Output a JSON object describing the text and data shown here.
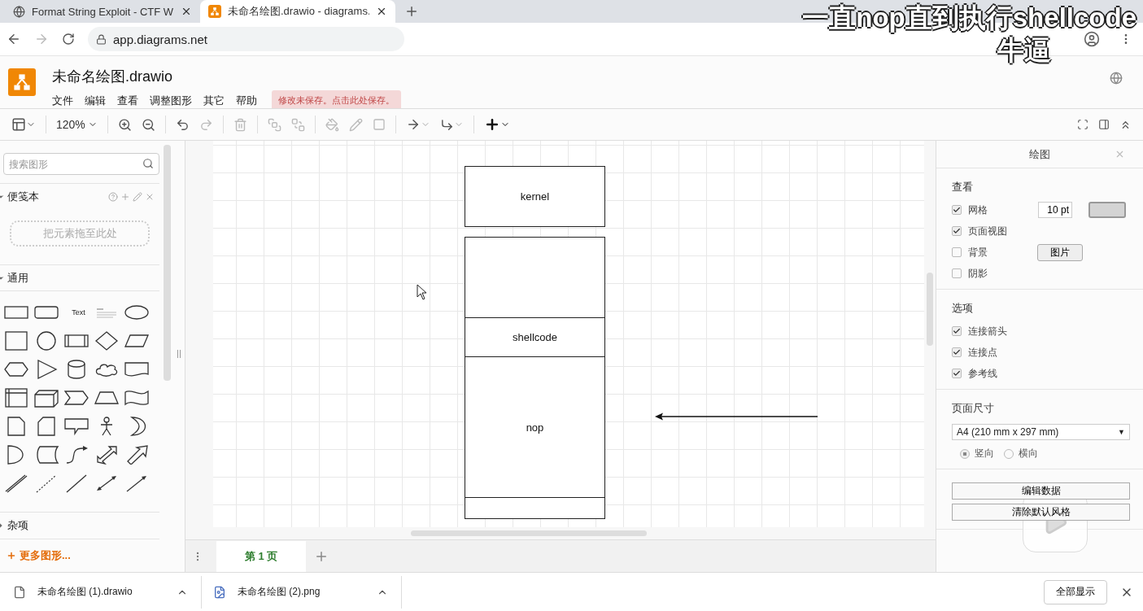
{
  "browser": {
    "tabs": [
      {
        "title": "Format String Exploit - CTF W",
        "selected": false,
        "kind": "web"
      },
      {
        "title": "未命名绘图.drawio - diagrams.",
        "selected": true,
        "kind": "drawio"
      }
    ],
    "url": "app.diagrams.net",
    "downloads": [
      {
        "name": "未命名绘图 (1).drawio",
        "kind": "file"
      },
      {
        "name": "未命名绘图 (2).png",
        "kind": "image"
      }
    ],
    "show_all": "全部显示"
  },
  "app": {
    "title": "未命名绘图.drawio",
    "menu": [
      "文件",
      "编辑",
      "查看",
      "调整图形",
      "其它",
      "帮助"
    ],
    "save_notice": "修改未保存。点击此处保存。",
    "zoom": "120%"
  },
  "sidebar": {
    "search_placeholder": "搜索图形",
    "sections": [
      {
        "title": "便笺本",
        "expanded": true,
        "kind": "scratchpad",
        "drop_hint": "把元素拖至此处"
      },
      {
        "title": "通用",
        "expanded": true,
        "kind": "palette",
        "text_shape": "Text"
      },
      {
        "title": "杂项",
        "expanded": false,
        "kind": "plain"
      }
    ],
    "more_shapes": "更多图形..."
  },
  "diagram": {
    "top_block": "kernel",
    "stack": [
      {
        "kind": "blank"
      },
      {
        "kind": "label",
        "label": "shellcode"
      },
      {
        "kind": "label",
        "label": "nop"
      },
      {
        "kind": "blank"
      }
    ]
  },
  "pages": [
    {
      "label": "第 1 页",
      "selected": true
    }
  ],
  "format_panel": {
    "title": "绘图",
    "view_heading": "查看",
    "view_options": [
      {
        "label": "网格",
        "checked": true
      },
      {
        "label": "页面视图",
        "checked": true
      },
      {
        "label": "背景",
        "checked": false
      },
      {
        "label": "阴影",
        "checked": false
      }
    ],
    "grid_size": "10 pt",
    "image_button": "图片",
    "options_heading": "选项",
    "options": [
      {
        "label": "连接箭头",
        "checked": true
      },
      {
        "label": "连接点",
        "checked": true
      },
      {
        "label": "参考线",
        "checked": true
      }
    ],
    "page_size_heading": "页面尺寸",
    "page_size": "A4 (210 mm x 297 mm)",
    "page_size_arrow": "▼",
    "orientation": [
      {
        "label": "竖向",
        "selected": true
      },
      {
        "label": "横向",
        "selected": false
      }
    ],
    "buttons": [
      "编辑数据",
      "清除默认风格"
    ]
  },
  "caption": [
    "一直nop直到执行shellcode",
    "牛逼"
  ]
}
